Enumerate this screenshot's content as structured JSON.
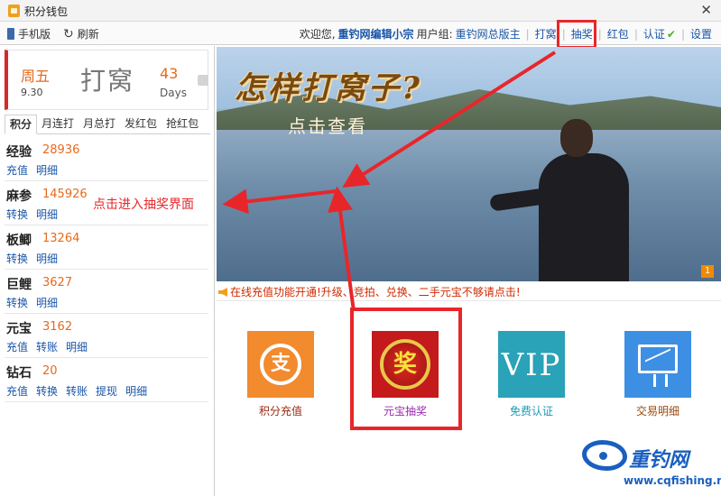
{
  "window": {
    "title": "积分钱包"
  },
  "toolbar": {
    "mobile_label": "手机版",
    "refresh_label": "刷新",
    "welcome": "欢迎您,",
    "username": "重钓网编辑小宗",
    "group_label": "用户组:",
    "group_value": "重钓网总版主",
    "checkin_label": "打窝",
    "lottery_label": "抽奖",
    "redpacket_label": "红包",
    "verify_label": "认证",
    "settings_label": "设置"
  },
  "date_card": {
    "weekday": "周五",
    "date": "9.30",
    "checkin_text": "打窝",
    "days_value": "43",
    "days_label": "Days"
  },
  "tabs": [
    "积分",
    "月连打",
    "月总打",
    "发红包",
    "抢红包"
  ],
  "points": [
    {
      "name": "经验",
      "value": "28936",
      "actions": [
        "充值",
        "明细"
      ]
    },
    {
      "name": "麻参",
      "value": "145926",
      "actions": [
        "转换",
        "明细"
      ]
    },
    {
      "name": "板鲫",
      "value": "13264",
      "actions": [
        "转换",
        "明细"
      ]
    },
    {
      "name": "巨鲤",
      "value": "3627",
      "actions": [
        "转换",
        "明细"
      ]
    },
    {
      "name": "元宝",
      "value": "3162",
      "actions": [
        "充值",
        "转账",
        "明细"
      ]
    },
    {
      "name": "钻石",
      "value": "20",
      "actions": [
        "充值",
        "转换",
        "转账",
        "提现",
        "明细"
      ]
    }
  ],
  "annotation": {
    "text": "点击进入抽奖界面",
    "color": "#e8262a"
  },
  "banner": {
    "headline": "怎样打窝子?",
    "subheadline": "点击查看",
    "page_indicator": "1"
  },
  "notice": {
    "text": "在线充值功能开通!升级、竞拍、兑换、二手元宝不够请点击!"
  },
  "tiles": [
    {
      "label": "积分充值",
      "glyph": "支"
    },
    {
      "label": "元宝抽奖",
      "glyph": "奖"
    },
    {
      "label": "免费认证",
      "glyph": "VIP"
    },
    {
      "label": "交易明细",
      "glyph": ""
    }
  ],
  "logo": {
    "brand": "重钓网",
    "url": "www.cqfishing.net"
  },
  "colors": {
    "accent_orange": "#e86a1b",
    "link_blue": "#1a56a8",
    "highlight_red": "#e8262a"
  }
}
